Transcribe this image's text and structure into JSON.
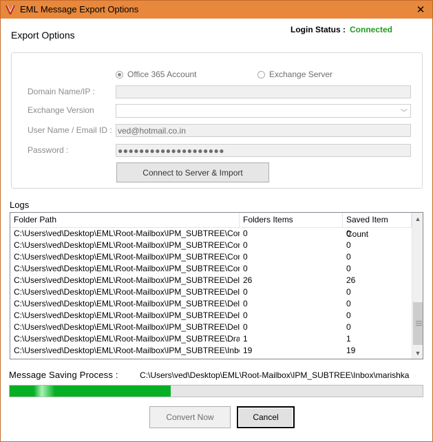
{
  "window": {
    "title": "EML Message Export Options",
    "close_glyph": "✕",
    "accent": "#e7883d"
  },
  "header": {
    "section_title": "Export Options",
    "login_status_label": "Login Status :",
    "login_status_value": "Connected",
    "status_color": "#1f9a1f"
  },
  "connection": {
    "radio_office365": "Office 365 Account",
    "radio_exchange": "Exchange Server",
    "selected": "office365",
    "domain_label": "Domain Name/IP :",
    "domain_value": "",
    "version_label": "Exchange Version",
    "version_value": "",
    "user_label": "User Name / Email ID :",
    "user_value": "ved@hotmail.co.in",
    "password_label": "Password :",
    "password_value": "●●●●●●●●●●●●●●●●●●●●",
    "connect_button": "Connect to Server & Import"
  },
  "logs": {
    "label": "Logs",
    "columns": [
      "Folder Path",
      "Folders Items",
      "Saved Item Count"
    ],
    "rows": [
      [
        "C:\\Users\\ved\\Desktop\\EML\\Root-Mailbox\\IPM_SUBTREE\\Cont...",
        "0",
        "0"
      ],
      [
        "C:\\Users\\ved\\Desktop\\EML\\Root-Mailbox\\IPM_SUBTREE\\Cont...",
        "0",
        "0"
      ],
      [
        "C:\\Users\\ved\\Desktop\\EML\\Root-Mailbox\\IPM_SUBTREE\\Cont...",
        "0",
        "0"
      ],
      [
        "C:\\Users\\ved\\Desktop\\EML\\Root-Mailbox\\IPM_SUBTREE\\Con...",
        "0",
        "0"
      ],
      [
        "C:\\Users\\ved\\Desktop\\EML\\Root-Mailbox\\IPM_SUBTREE\\Dele...",
        "26",
        "26"
      ],
      [
        "C:\\Users\\ved\\Desktop\\EML\\Root-Mailbox\\IPM_SUBTREE\\Dele...",
        "0",
        "0"
      ],
      [
        "C:\\Users\\ved\\Desktop\\EML\\Root-Mailbox\\IPM_SUBTREE\\Dele...",
        "0",
        "0"
      ],
      [
        "C:\\Users\\ved\\Desktop\\EML\\Root-Mailbox\\IPM_SUBTREE\\Dele...",
        "0",
        "0"
      ],
      [
        "C:\\Users\\ved\\Desktop\\EML\\Root-Mailbox\\IPM_SUBTREE\\Dele...",
        "0",
        "0"
      ],
      [
        "C:\\Users\\ved\\Desktop\\EML\\Root-Mailbox\\IPM_SUBTREE\\Drafts",
        "1",
        "1"
      ],
      [
        "C:\\Users\\ved\\Desktop\\EML\\Root-Mailbox\\IPM_SUBTREE\\Inbox",
        "19",
        "19"
      ]
    ]
  },
  "progress": {
    "label": "Message Saving Process :",
    "current_path": "C:\\Users\\ved\\Desktop\\EML\\Root-Mailbox\\IPM_SUBTREE\\Inbox\\marishka",
    "fraction": 0.39,
    "color": "#06b025"
  },
  "footer": {
    "convert_button": "Convert Now",
    "cancel_button": "Cancel"
  }
}
